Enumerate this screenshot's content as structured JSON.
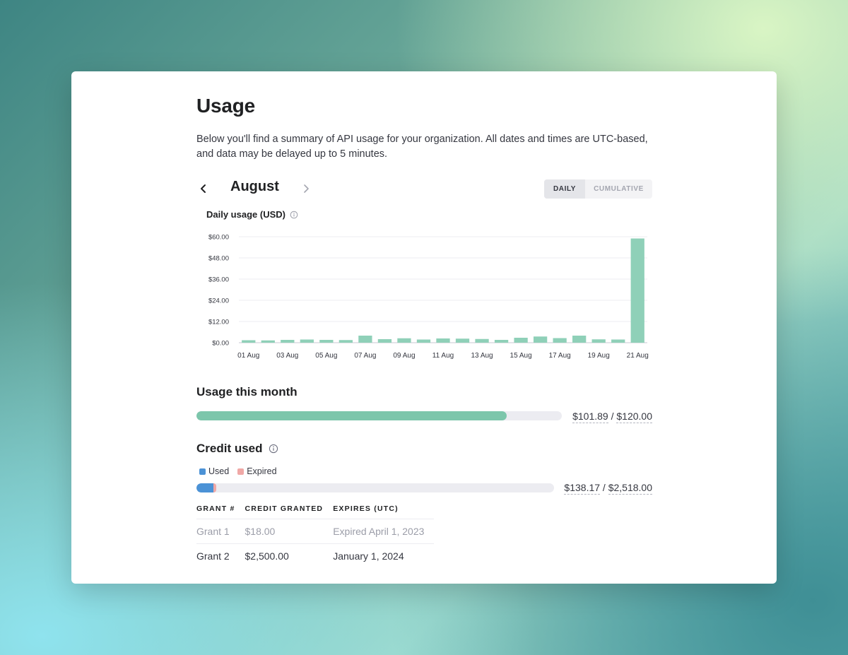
{
  "page": {
    "title": "Usage",
    "description": "Below you'll find a summary of API usage for your organization. All dates and times are UTC-based, and data may be delayed up to 5 minutes."
  },
  "month_nav": {
    "month": "August",
    "prev_icon": "chevron-left-icon",
    "next_icon": "chevron-right-icon"
  },
  "view_toggle": {
    "daily_label": "DAILY",
    "cumulative_label": "CUMULATIVE",
    "selected": "DAILY"
  },
  "chart_data": {
    "type": "bar",
    "title": "Daily usage (USD)",
    "xlabel": "",
    "ylabel": "",
    "ylim": [
      0,
      60
    ],
    "yticks": [
      "$0.00",
      "$12.00",
      "$24.00",
      "$36.00",
      "$48.00",
      "$60.00"
    ],
    "ytick_values": [
      0,
      12,
      24,
      36,
      48,
      60
    ],
    "categories": [
      "01 Aug",
      "02 Aug",
      "03 Aug",
      "04 Aug",
      "05 Aug",
      "06 Aug",
      "07 Aug",
      "08 Aug",
      "09 Aug",
      "10 Aug",
      "11 Aug",
      "12 Aug",
      "13 Aug",
      "14 Aug",
      "15 Aug",
      "16 Aug",
      "17 Aug",
      "18 Aug",
      "19 Aug",
      "20 Aug",
      "21 Aug"
    ],
    "xtick_labels": [
      "01 Aug",
      "03 Aug",
      "05 Aug",
      "07 Aug",
      "09 Aug",
      "11 Aug",
      "13 Aug",
      "15 Aug",
      "17 Aug",
      "19 Aug",
      "21 Aug"
    ],
    "values": [
      1.4,
      1.3,
      1.6,
      1.8,
      1.6,
      1.5,
      4.0,
      2.0,
      2.5,
      1.8,
      2.4,
      2.3,
      2.1,
      1.6,
      2.8,
      3.5,
      2.6,
      4.0,
      1.9,
      1.8,
      59.0
    ],
    "bar_color": "#8fd0b8",
    "grid": true,
    "legend": "none"
  },
  "usage_month": {
    "title": "Usage this month",
    "used": "$101.89",
    "limit": "$120.00",
    "separator": "/",
    "fraction": 0.849,
    "color": "#7cc6ab"
  },
  "credit": {
    "title": "Credit used",
    "legend_used": "Used",
    "legend_expired": "Expired",
    "used_color": "#4b92d6",
    "expired_color": "#f0a8a6",
    "used_total": "$138.17",
    "granted_total": "$2,518.00",
    "separator": "/",
    "used_fraction": 0.048,
    "expired_fraction": 0.007,
    "table": {
      "headers": [
        "GRANT #",
        "CREDIT GRANTED",
        "EXPIRES (UTC)"
      ],
      "rows": [
        [
          "Grant 1",
          "$18.00",
          "Expired April 1, 2023"
        ],
        [
          "Grant 2",
          "$2,500.00",
          "January 1, 2024"
        ]
      ]
    }
  }
}
